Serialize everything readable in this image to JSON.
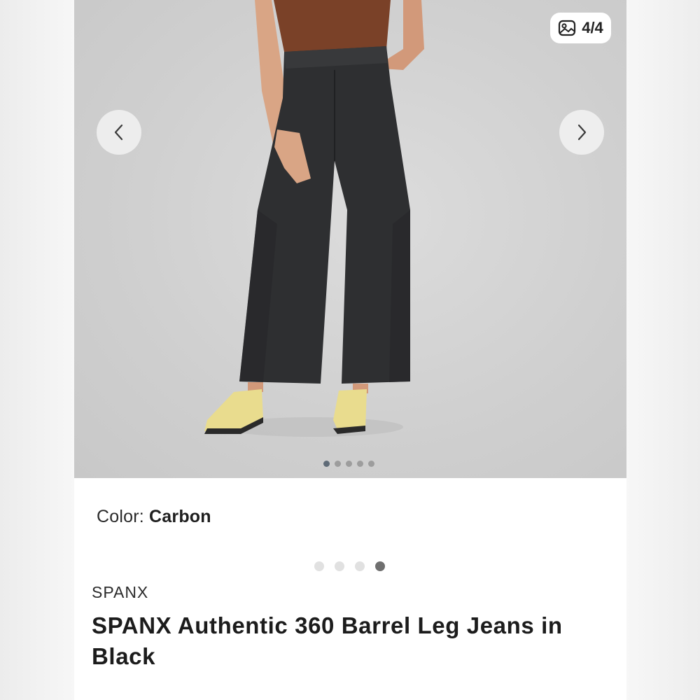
{
  "gallery": {
    "counter_text": "4/4",
    "dots_count": 5,
    "active_dot": 0
  },
  "product": {
    "color_label": "Color:",
    "color_value": "Carbon",
    "brand": "SPANX",
    "title": "SPANX Authentic 360 Barrel Leg Jeans in Black"
  },
  "pager": {
    "count": 4,
    "active": 3
  },
  "icons": {
    "prev": "chevron-left-icon",
    "next": "chevron-right-icon",
    "counter": "image-gallery-icon"
  },
  "colors": {
    "jeans": "#2e2f31",
    "top": "#7a4128",
    "shoes": "#e9dc8e",
    "skin": "#d9a585"
  }
}
